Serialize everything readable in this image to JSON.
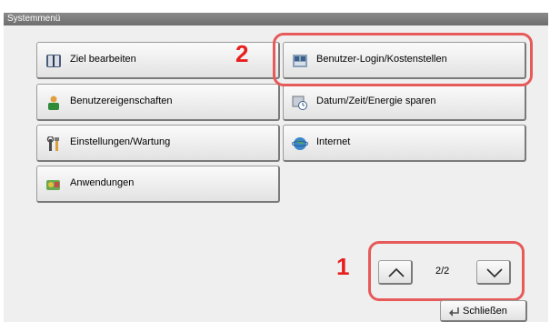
{
  "window": {
    "title": "Systemmenü"
  },
  "menu": {
    "items": [
      {
        "label": "Ziel bearbeiten",
        "icon": "address-book-icon"
      },
      {
        "label": "Benutzer-Login/Kostenstellen",
        "icon": "user-login-icon"
      },
      {
        "label": "Benutzereigenschaften",
        "icon": "user-properties-icon"
      },
      {
        "label": "Datum/Zeit/Energie sparen",
        "icon": "date-time-energy-icon"
      },
      {
        "label": "Einstellungen/Wartung",
        "icon": "tools-icon"
      },
      {
        "label": "Internet",
        "icon": "globe-icon"
      },
      {
        "label": "Anwendungen",
        "icon": "applications-icon"
      }
    ]
  },
  "annotations": {
    "callout_1": "1",
    "callout_2": "2"
  },
  "pagination": {
    "current_display": "2/2",
    "up_icon": "chevron-up-icon",
    "down_icon": "chevron-down-icon"
  },
  "footer": {
    "close_label": "Schließen",
    "close_icon": "return-arrow-icon"
  },
  "colors": {
    "highlight_ring": "#e65a5a",
    "callout_text": "#e81f1f",
    "titlebar": "#7b7b7b"
  }
}
